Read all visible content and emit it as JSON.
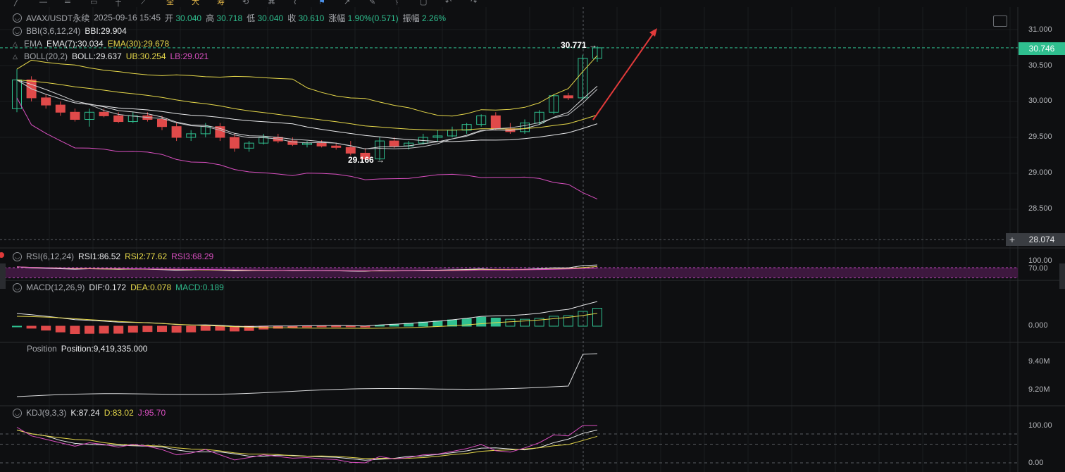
{
  "header": {
    "symbol": "AVAX/USDT永续",
    "datetime": "2025-09-16 15:45",
    "open_label": "开",
    "open": "30.040",
    "high_label": "高",
    "high": "30.718",
    "low_label": "低",
    "low": "30.040",
    "close_label": "收",
    "close": "30.610",
    "change_label": "涨幅",
    "change": "1.90%(0.571)",
    "amp_label": "振幅",
    "amp": "2.26%"
  },
  "toolbar": {
    "icons": [
      "pencil-icon",
      "minus-icon",
      "square-icon",
      "star-icon",
      "fan-icon",
      "fib-icon",
      "text-icon",
      "cursor-icon",
      "flag-icon",
      "pen-icon",
      "measure-icon",
      "line-icon",
      "trend-icon",
      "brush-icon",
      "lock-icon",
      "trash-icon",
      "undo-icon",
      "redo-icon"
    ],
    "glyphs": [
      "全",
      "大",
      "寿"
    ]
  },
  "indicators": {
    "bbi": {
      "name": "BBI(3,6,12,24)",
      "value": "BBI:29.904"
    },
    "ema": {
      "name": "EMA",
      "v1": "EMA(7):30.034",
      "v2": "EMA(30):29.678"
    },
    "boll": {
      "name": "BOLL(20,2)",
      "mid": "BOLL:29.637",
      "ub": "UB:30.254",
      "lb": "LB:29.021"
    },
    "rsi": {
      "name": "RSI(6,12,24)",
      "r1": "RSI1:86.52",
      "r2": "RSI2:77.62",
      "r3": "RSI3:68.29"
    },
    "macd": {
      "name": "MACD(12,26,9)",
      "dif": "DIF:0.172",
      "dea": "DEA:0.078",
      "macd": "MACD:0.189"
    },
    "position": {
      "name": "Position",
      "value": "Position:9,419,335.000"
    },
    "kdj": {
      "name": "KDJ(9,3,3)",
      "k": "K:87.24",
      "d": "D:83.02",
      "j": "J:95.70"
    }
  },
  "price_axis": {
    "main": [
      "31.000",
      "30.500",
      "30.000",
      "29.500",
      "29.000",
      "28.500"
    ],
    "current_price": "30.746",
    "cursor_price": "28.074",
    "rsi": [
      "100.00",
      "70.00"
    ],
    "macd": [
      "0.000"
    ],
    "position": [
      "9.40M",
      "9.20M"
    ],
    "kdj": [
      "100.00",
      "0.00"
    ]
  },
  "annotations": {
    "high_mark": "30.771 →",
    "low_mark": "29.166 →"
  },
  "colors": {
    "up": "#2fbf8f",
    "down": "#e04a4a",
    "yellow": "#e6d84a",
    "magenta": "#d94fc0",
    "current": "#2fbf8f",
    "bg": "#0e0f11"
  },
  "chart_data": {
    "type": "candlestick",
    "candles": [
      {
        "o": 29.9,
        "h": 30.45,
        "l": 29.85,
        "c": 30.3
      },
      {
        "o": 30.3,
        "h": 30.35,
        "l": 30.0,
        "c": 30.05
      },
      {
        "o": 30.05,
        "h": 30.1,
        "l": 29.9,
        "c": 29.95
      },
      {
        "o": 29.95,
        "h": 30.0,
        "l": 29.8,
        "c": 29.85
      },
      {
        "o": 29.85,
        "h": 29.9,
        "l": 29.72,
        "c": 29.75
      },
      {
        "o": 29.75,
        "h": 29.9,
        "l": 29.65,
        "c": 29.85
      },
      {
        "o": 29.85,
        "h": 29.9,
        "l": 29.78,
        "c": 29.8
      },
      {
        "o": 29.8,
        "h": 29.85,
        "l": 29.7,
        "c": 29.72
      },
      {
        "o": 29.72,
        "h": 29.85,
        "l": 29.7,
        "c": 29.8
      },
      {
        "o": 29.8,
        "h": 29.85,
        "l": 29.72,
        "c": 29.75
      },
      {
        "o": 29.75,
        "h": 29.8,
        "l": 29.6,
        "c": 29.65
      },
      {
        "o": 29.65,
        "h": 29.7,
        "l": 29.45,
        "c": 29.5
      },
      {
        "o": 29.5,
        "h": 29.6,
        "l": 29.45,
        "c": 29.55
      },
      {
        "o": 29.55,
        "h": 29.7,
        "l": 29.5,
        "c": 29.65
      },
      {
        "o": 29.65,
        "h": 29.7,
        "l": 29.45,
        "c": 29.5
      },
      {
        "o": 29.5,
        "h": 29.55,
        "l": 29.3,
        "c": 29.35
      },
      {
        "o": 29.35,
        "h": 29.45,
        "l": 29.3,
        "c": 29.42
      },
      {
        "o": 29.42,
        "h": 29.55,
        "l": 29.4,
        "c": 29.5
      },
      {
        "o": 29.5,
        "h": 29.55,
        "l": 29.42,
        "c": 29.45
      },
      {
        "o": 29.45,
        "h": 29.5,
        "l": 29.38,
        "c": 29.4
      },
      {
        "o": 29.4,
        "h": 29.45,
        "l": 29.36,
        "c": 29.42
      },
      {
        "o": 29.42,
        "h": 29.46,
        "l": 29.36,
        "c": 29.38
      },
      {
        "o": 29.38,
        "h": 29.42,
        "l": 29.33,
        "c": 29.36
      },
      {
        "o": 29.36,
        "h": 29.45,
        "l": 29.25,
        "c": 29.28
      },
      {
        "o": 29.28,
        "h": 29.35,
        "l": 29.17,
        "c": 29.2
      },
      {
        "o": 29.2,
        "h": 29.5,
        "l": 29.18,
        "c": 29.45
      },
      {
        "o": 29.45,
        "h": 29.5,
        "l": 29.35,
        "c": 29.38
      },
      {
        "o": 29.38,
        "h": 29.45,
        "l": 29.33,
        "c": 29.42
      },
      {
        "o": 29.42,
        "h": 29.55,
        "l": 29.4,
        "c": 29.5
      },
      {
        "o": 29.5,
        "h": 29.6,
        "l": 29.45,
        "c": 29.52
      },
      {
        "o": 29.52,
        "h": 29.65,
        "l": 29.5,
        "c": 29.6
      },
      {
        "o": 29.6,
        "h": 29.7,
        "l": 29.55,
        "c": 29.68
      },
      {
        "o": 29.68,
        "h": 29.82,
        "l": 29.65,
        "c": 29.8
      },
      {
        "o": 29.8,
        "h": 29.85,
        "l": 29.6,
        "c": 29.62
      },
      {
        "o": 29.62,
        "h": 29.7,
        "l": 29.55,
        "c": 29.58
      },
      {
        "o": 29.58,
        "h": 29.75,
        "l": 29.55,
        "c": 29.7
      },
      {
        "o": 29.7,
        "h": 29.88,
        "l": 29.68,
        "c": 29.85
      },
      {
        "o": 29.85,
        "h": 30.1,
        "l": 29.82,
        "c": 30.08
      },
      {
        "o": 30.08,
        "h": 30.12,
        "l": 30.02,
        "c": 30.05
      },
      {
        "o": 30.05,
        "h": 30.65,
        "l": 30.02,
        "c": 30.6
      },
      {
        "o": 30.6,
        "h": 30.77,
        "l": 30.55,
        "c": 30.746
      }
    ]
  }
}
